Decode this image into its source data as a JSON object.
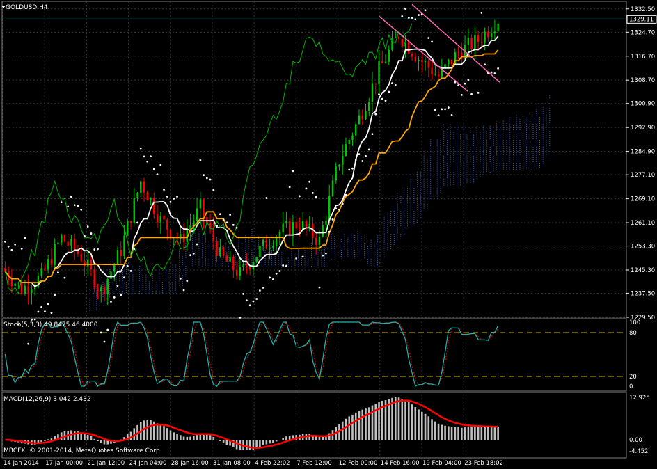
{
  "window": {
    "title": "GOLDUSD,H4",
    "copyright": "MBCFX, © 2001-2014, MetaQuotes Software Corp."
  },
  "chart_data": [
    {
      "type": "candlestick",
      "name": "main",
      "symbol": "GOLDUSD",
      "timeframe": "H4",
      "ylim": [
        1229.5,
        1335.0
      ],
      "y_ticks": [
        "1332.50",
        "1324.70",
        "1316.70",
        "1308.70",
        "1300.90",
        "1292.90",
        "1284.90",
        "1277.10",
        "1269.10",
        "1261.10",
        "1253.30",
        "1245.30",
        "1237.50",
        "1229.50"
      ],
      "y_tick_values": [
        1332.5,
        1324.7,
        1316.7,
        1308.7,
        1300.9,
        1292.9,
        1284.9,
        1277.1,
        1269.1,
        1261.1,
        1253.3,
        1245.3,
        1237.5,
        1229.5
      ],
      "current_price": "1329.11",
      "current_price_value": 1329.11,
      "x_ticks": [
        "14 Jan 2014",
        "17 Jan 00:00",
        "21 Jan 12:00",
        "24 Jan 04:00",
        "28 Jan 16:00",
        "31 Jan 08:00",
        "4 Feb 22:02",
        "7 Feb 12:00",
        "12 Feb 00:00",
        "14 Feb 16:00",
        "19 Feb 04:00",
        "23 Feb 18:02"
      ],
      "close_path": [
        [
          0,
          1246
        ],
        [
          6,
          1239
        ],
        [
          12,
          1243
        ],
        [
          18,
          1256
        ],
        [
          24,
          1250
        ],
        [
          30,
          1238
        ],
        [
          36,
          1252
        ],
        [
          42,
          1275
        ],
        [
          48,
          1262
        ],
        [
          54,
          1255
        ],
        [
          60,
          1266
        ],
        [
          66,
          1250
        ],
        [
          72,
          1244
        ],
        [
          78,
          1252
        ],
        [
          84,
          1258
        ],
        [
          90,
          1261
        ],
        [
          96,
          1255
        ],
        [
          102,
          1282
        ],
        [
          108,
          1296
        ],
        [
          114,
          1312
        ],
        [
          120,
          1324
        ],
        [
          126,
          1316
        ],
        [
          132,
          1310
        ],
        [
          138,
          1318
        ],
        [
          144,
          1322
        ],
        [
          150,
          1329.11
        ]
      ],
      "n_candles": 150,
      "indicators": {
        "ichimoku_cloud": {
          "colors": {
            "bull": "#3a5fcd",
            "bear": "#8b1a1a"
          }
        },
        "tenkan_color": "#ffffff",
        "kijun_color": "#ffa500",
        "chikou_color": "#00b400",
        "parabolic_sar_color": "#ffffff",
        "trend_channel_color": "#ff69b4"
      },
      "colors": {
        "bull": "#00c800",
        "bear": "#ff0000",
        "grid": "#3a3a3a"
      }
    },
    {
      "type": "line",
      "name": "stochastic",
      "label": "Stoch(5,3,3) 49.8475 46.4000",
      "ylim": [
        0,
        100
      ],
      "y_ticks": [
        "100",
        "80",
        "20",
        "0"
      ],
      "y_tick_values": [
        100,
        80,
        20,
        0
      ],
      "levels": [
        80,
        20
      ],
      "main_color": "#20b2aa",
      "signal_color": "#ff0000"
    },
    {
      "type": "bar",
      "name": "macd",
      "label": "MACD(12,26,9) 3.042 2.432",
      "ylim": [
        -4.452,
        12.925
      ],
      "y_ticks": [
        "12.925",
        "0.00",
        "-4.452"
      ],
      "y_tick_values": [
        12.925,
        0.0,
        -4.452
      ],
      "histogram_color": "#c0c0c0",
      "signal_color": "#ff0000"
    }
  ]
}
